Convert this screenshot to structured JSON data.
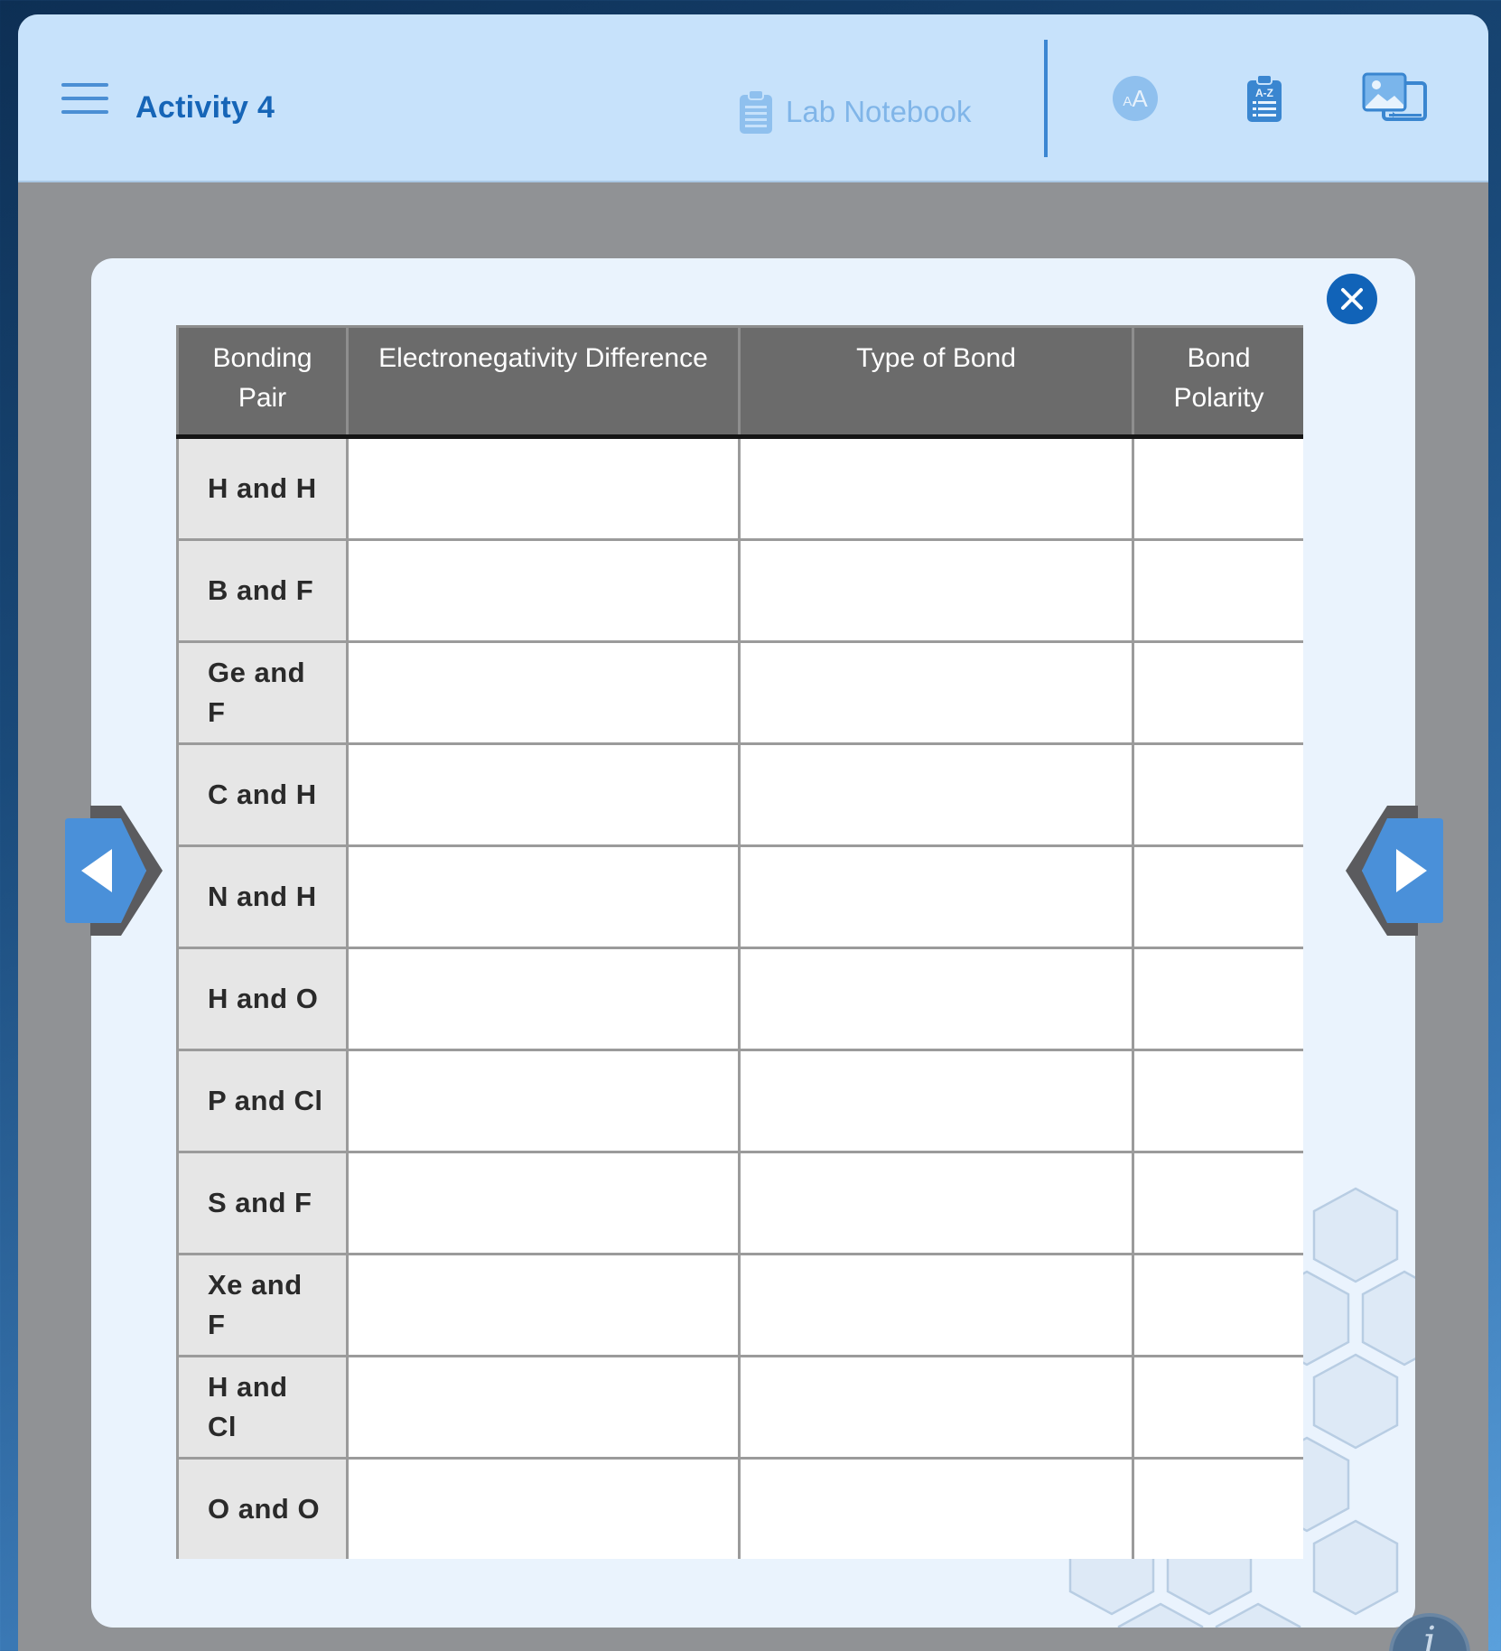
{
  "header": {
    "menu_icon": "hamburger-menu-icon",
    "title": "Activity 4",
    "notebook_label": "Lab Notebook",
    "notebook_icon": "clipboard-icon",
    "text_size_label_small": "A",
    "text_size_label_big": "A",
    "glossary_icon_text": "A-Z",
    "media_icon": "image-gallery-icon"
  },
  "colors": {
    "topbar_bg": "#c7e2fb",
    "accent": "#1665b7",
    "table_header_bg": "#6b6b6b",
    "label_cell_bg": "#e6e6e6",
    "nav_button": "#4a90d9"
  },
  "table": {
    "headers": [
      "Bonding Pair",
      "Electronegativity Difference",
      "Type of Bond",
      "Bond Polarity"
    ],
    "rows": [
      {
        "pair": "H and H",
        "diff": "",
        "type": "",
        "polarity": ""
      },
      {
        "pair": "B and F",
        "diff": "",
        "type": "",
        "polarity": ""
      },
      {
        "pair": "Ge and F",
        "diff": "",
        "type": "",
        "polarity": ""
      },
      {
        "pair": "C and H",
        "diff": "",
        "type": "",
        "polarity": ""
      },
      {
        "pair": "N and H",
        "diff": "",
        "type": "",
        "polarity": ""
      },
      {
        "pair": "H and O",
        "diff": "",
        "type": "",
        "polarity": ""
      },
      {
        "pair": "P and Cl",
        "diff": "",
        "type": "",
        "polarity": ""
      },
      {
        "pair": "S and F",
        "diff": "",
        "type": "",
        "polarity": ""
      },
      {
        "pair": "Xe and F",
        "diff": "",
        "type": "",
        "polarity": ""
      },
      {
        "pair": "H and Cl",
        "diff": "",
        "type": "",
        "polarity": ""
      },
      {
        "pair": "O and O",
        "diff": "",
        "type": "",
        "polarity": ""
      }
    ]
  },
  "nav": {
    "prev_icon": "arrow-left-icon",
    "next_icon": "arrow-right-icon",
    "close_icon": "close-icon",
    "info_label": "i"
  }
}
